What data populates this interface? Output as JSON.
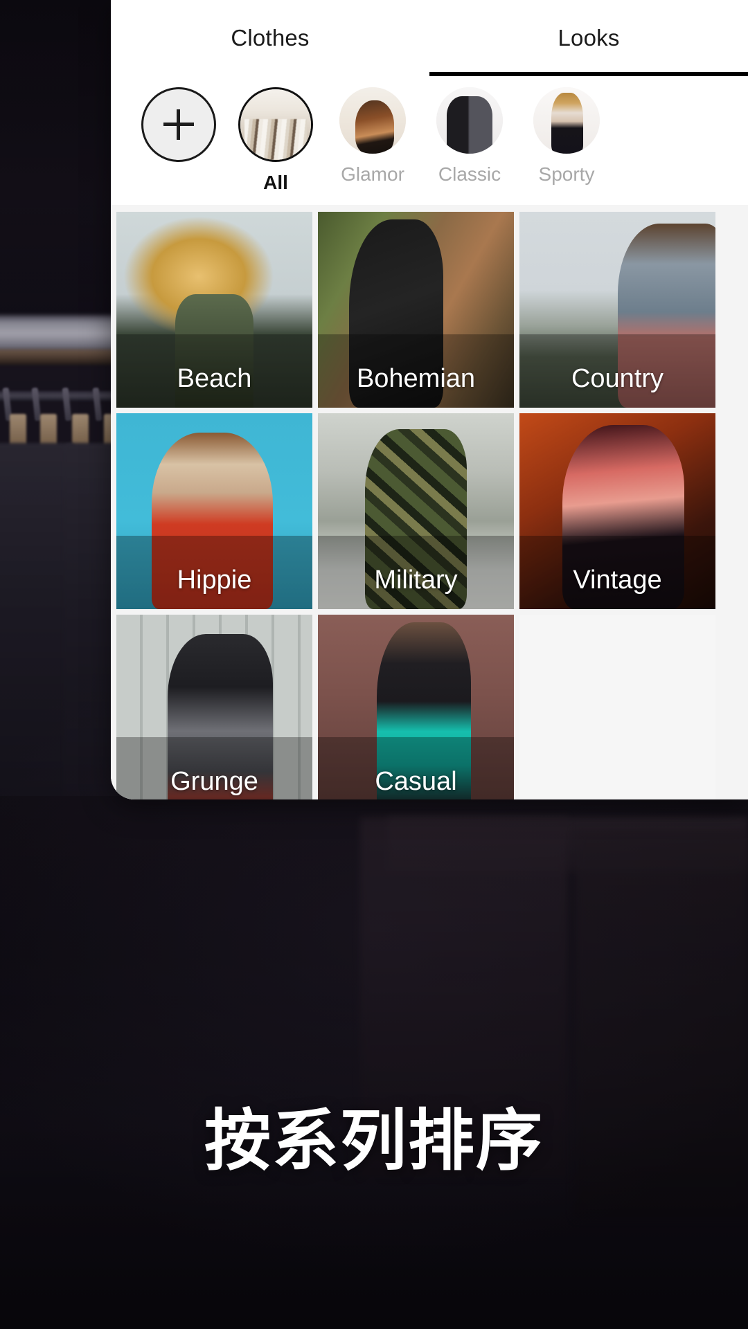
{
  "tabs": [
    {
      "label": "Clothes",
      "active": false
    },
    {
      "label": "Looks",
      "active": true
    }
  ],
  "categories": [
    {
      "label": "",
      "icon": "plus-icon",
      "type": "add",
      "selected": false
    },
    {
      "label": "All",
      "icon": "clothes-rack-thumb",
      "type": "photo",
      "selected": true
    },
    {
      "label": "Glamor",
      "icon": "glamor-thumb",
      "type": "photo",
      "selected": false
    },
    {
      "label": "Classic",
      "icon": "classic-thumb",
      "type": "photo",
      "selected": false
    },
    {
      "label": "Sporty",
      "icon": "sporty-thumb",
      "type": "photo",
      "selected": false
    }
  ],
  "looks": [
    {
      "name": "Beach",
      "art": "a-beach"
    },
    {
      "name": "Bohemian",
      "art": "a-boho"
    },
    {
      "name": "Country",
      "art": "a-country"
    },
    {
      "name": "Hippie",
      "art": "a-hippie"
    },
    {
      "name": "Military",
      "art": "a-military"
    },
    {
      "name": "Vintage",
      "art": "a-vintage"
    },
    {
      "name": "Grunge",
      "art": "a-grunge"
    },
    {
      "name": "Casual",
      "art": "a-casual"
    }
  ],
  "caption": {
    "text": "按系列排序"
  },
  "colors": {
    "accent": "#000000",
    "card_background": "#ffffff",
    "grid_background": "#f4f4f4",
    "inactive_label": "#a8a8a8",
    "active_label": "#111111",
    "tile_label": "#ffffff",
    "page_background": "#14101a"
  }
}
